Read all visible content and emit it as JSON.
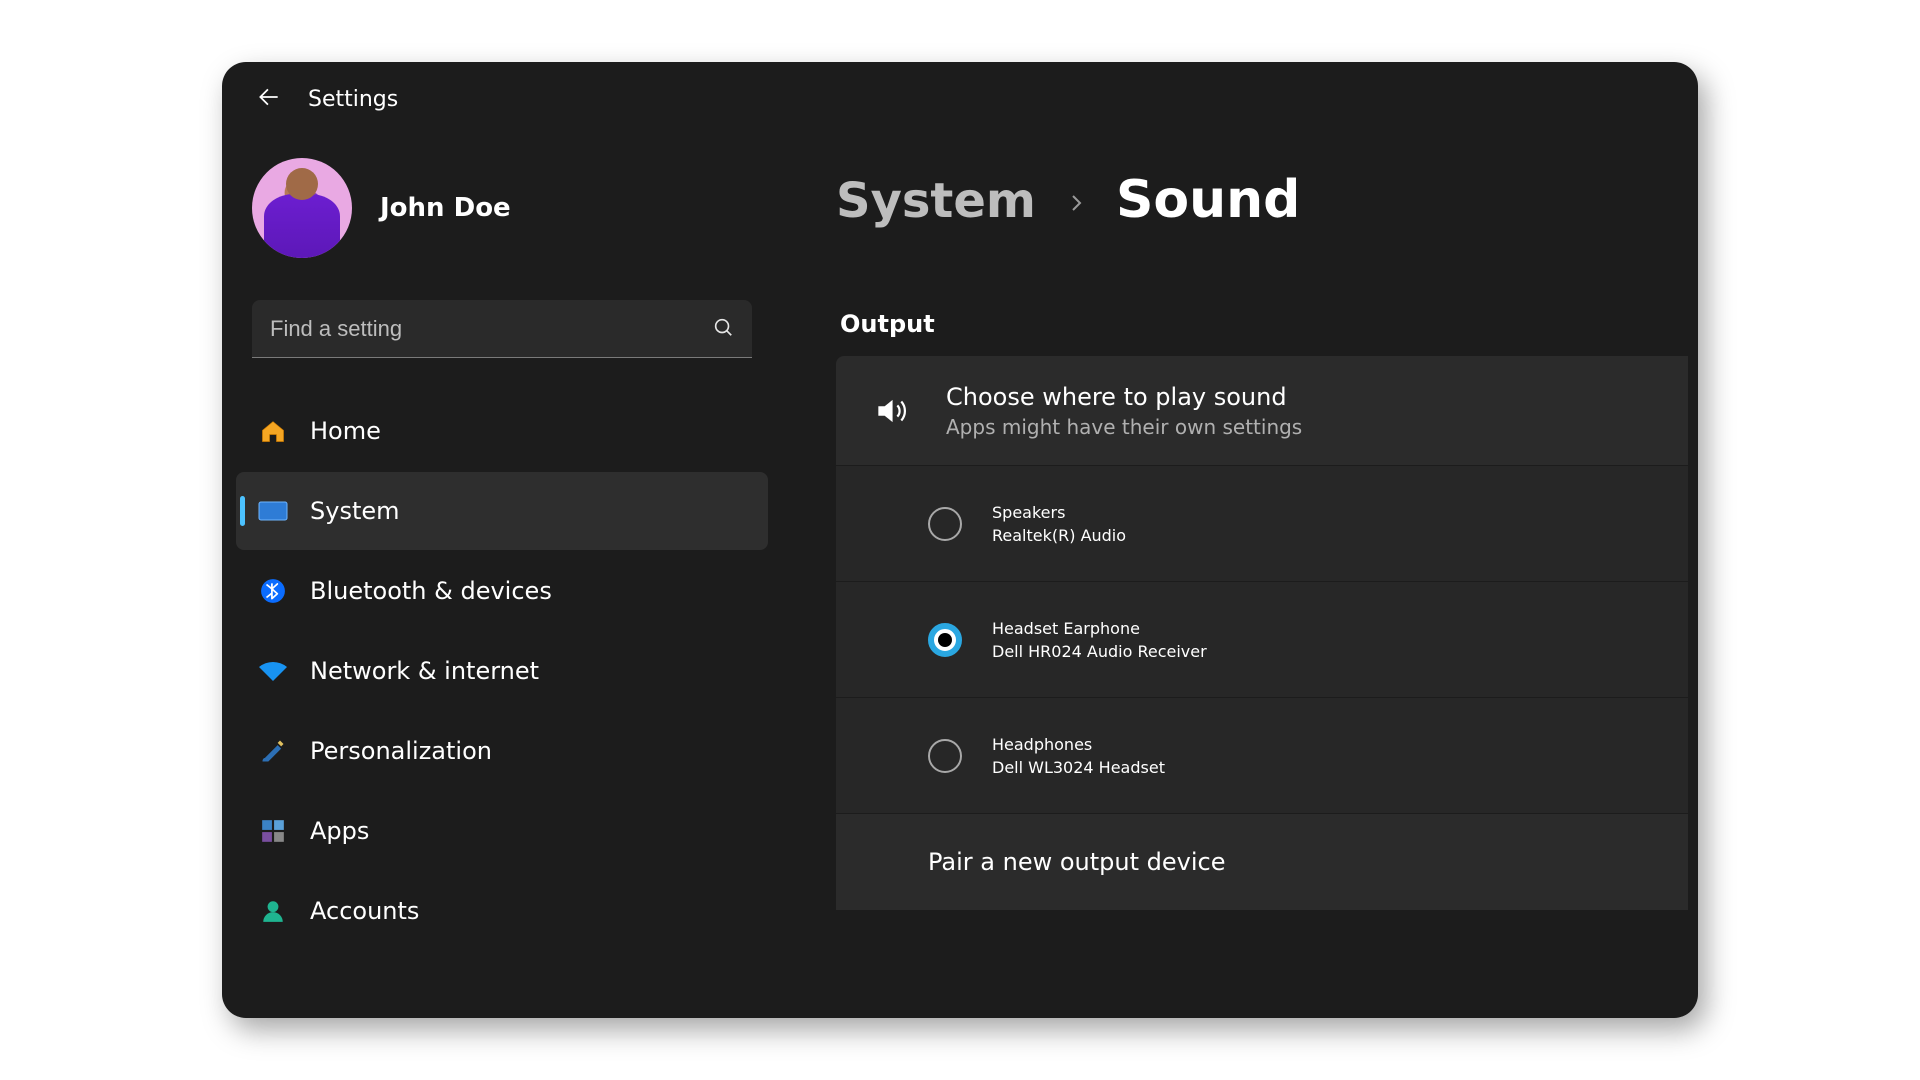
{
  "window": {
    "title": "Settings"
  },
  "user": {
    "name": "John Doe"
  },
  "search": {
    "placeholder": "Find a setting"
  },
  "sidebar": {
    "items": [
      {
        "icon": "home",
        "label": "Home",
        "active": false
      },
      {
        "icon": "system",
        "label": "System",
        "active": true
      },
      {
        "icon": "bluetooth",
        "label": "Bluetooth & devices",
        "active": false
      },
      {
        "icon": "network",
        "label": "Network & internet",
        "active": false
      },
      {
        "icon": "personalize",
        "label": "Personalization",
        "active": false
      },
      {
        "icon": "apps",
        "label": "Apps",
        "active": false
      },
      {
        "icon": "accounts",
        "label": "Accounts",
        "active": false
      }
    ]
  },
  "breadcrumb": {
    "parent": "System",
    "current": "Sound"
  },
  "output": {
    "heading": "Output",
    "choose": {
      "title": "Choose where to play sound",
      "subtitle": "Apps might have their own settings"
    },
    "devices": [
      {
        "name": "Speakers",
        "detail": "Realtek(R) Audio",
        "selected": false
      },
      {
        "name": "Headset Earphone",
        "detail": "Dell HR024 Audio Receiver",
        "selected": true
      },
      {
        "name": "Headphones",
        "detail": "Dell WL3024 Headset",
        "selected": false
      }
    ],
    "pair_label": "Pair a new output device"
  }
}
